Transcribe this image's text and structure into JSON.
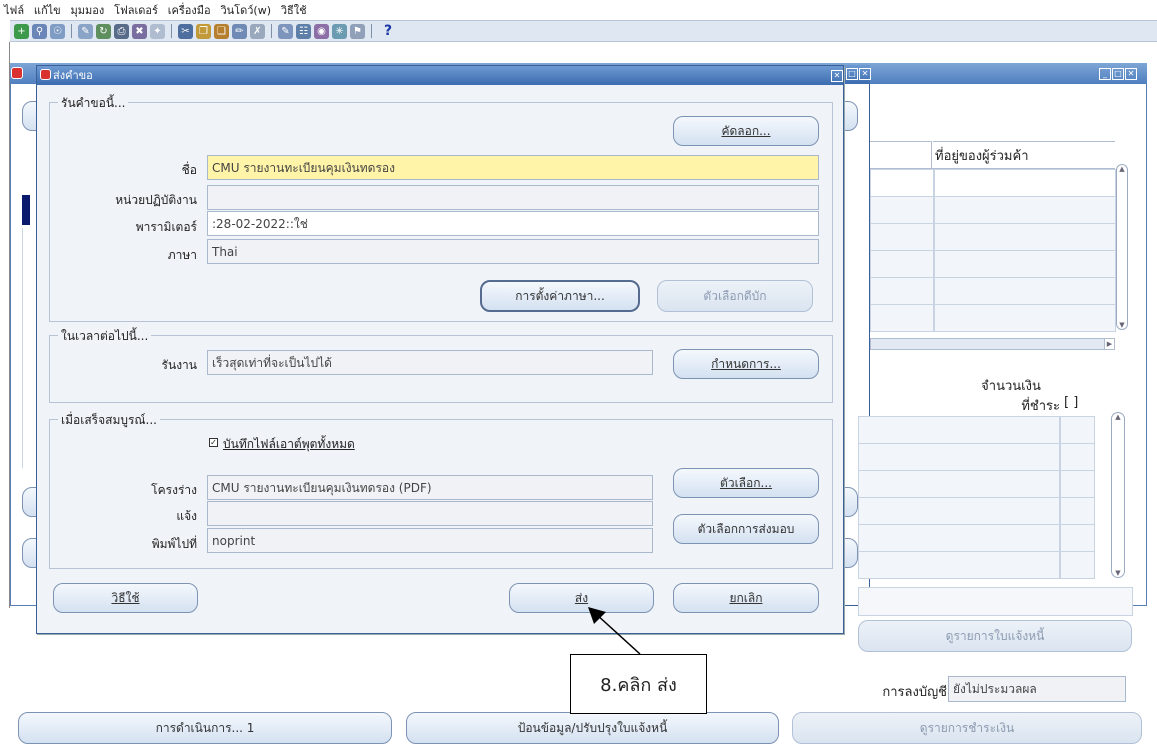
{
  "menubar": {
    "items": [
      "ไฟล์",
      "แก้ไข",
      "มุมมอง",
      "โฟลเดอร์",
      "เครื่องมือ",
      "วินโดว์(w)",
      "วิธีใช้"
    ]
  },
  "toolbar": {
    "help_label": "?"
  },
  "background": {
    "col_vendor_address": "ที่อยู่ของผู้ร่วมค้า",
    "amount_header_line1": "จำนวนเงิน",
    "amount_header_line2": "ที่ชำระ",
    "amount_bracket": "[ ]",
    "view_invoice_button": "ดูรายการใบแจ้งหนี้",
    "accounting_label": "การลงบัญชี",
    "accounting_value": "ยังไม่ประมวลผล",
    "actions_button": "การดำเนินการ... 1",
    "enter_update_button": "ป้อนข้อมูล/ปรับปรุงใบแจ้งหนี้",
    "view_payments_button": "ดูรายการชำระเงิน"
  },
  "dialog": {
    "title": "ส่งคำขอ",
    "section_run_request": "รันคำขอนี้...",
    "copy_button": "คัดลอก...",
    "name_label": "ชื่อ",
    "name_value": "CMU รายงานทะเบียนคุมเงินทดรอง",
    "op_unit_label": "หน่วยปฏิบัติงาน",
    "op_unit_value": "",
    "params_label": "พารามิเตอร์",
    "params_value": ":28-02-2022::ใช่",
    "language_label": "ภาษา",
    "language_value": "Thai",
    "language_settings_button": "การตั้งค่าภาษา...",
    "debug_options_button": "ตัวเลือกดีบัก",
    "section_next_time": "ในเวลาต่อไปนี้...",
    "run_label": "รันงาน",
    "run_value": "เร็วสุดเท่าที่จะเป็นไปได้",
    "schedule_button": "กำหนดการ...",
    "section_on_complete": "เมื่อเสร็จสมบูรณ์...",
    "save_output_label": "บันทึกไฟล์เอาต์พุตทั้งหมด",
    "save_output_checked": true,
    "layout_label": "โครงร่าง",
    "layout_value": "CMU รายงานทะเบียนคุมเงินทดรอง (PDF)",
    "options_button": "ตัวเลือก...",
    "notify_label": "แจ้ง",
    "notify_value": "",
    "print_to_label": "พิมพ์ไปที่",
    "print_to_value": "noprint",
    "delivery_options_button": "ตัวเลือกการส่งมอบ",
    "help_button": "วิธีใช้",
    "submit_button": "ส่ง",
    "cancel_button": "ยกเลิก"
  },
  "callout": {
    "text": "8.คลิก ส่ง"
  }
}
